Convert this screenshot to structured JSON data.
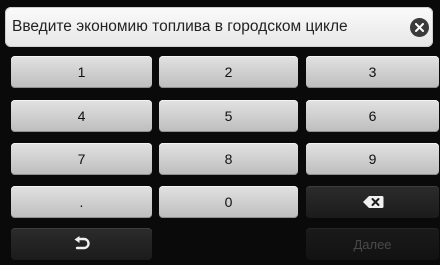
{
  "prompt": {
    "text": "Введите экономию топлива в городском цикле",
    "close_icon": "close-icon"
  },
  "keypad": {
    "rows": [
      [
        "1",
        "2",
        "3"
      ],
      [
        "4",
        "5",
        "6"
      ],
      [
        "7",
        "8",
        "9"
      ],
      [
        ".",
        "0"
      ]
    ],
    "backspace_icon": "backspace-icon",
    "back_icon": "back-arrow-icon",
    "next_label": "Далее"
  }
}
